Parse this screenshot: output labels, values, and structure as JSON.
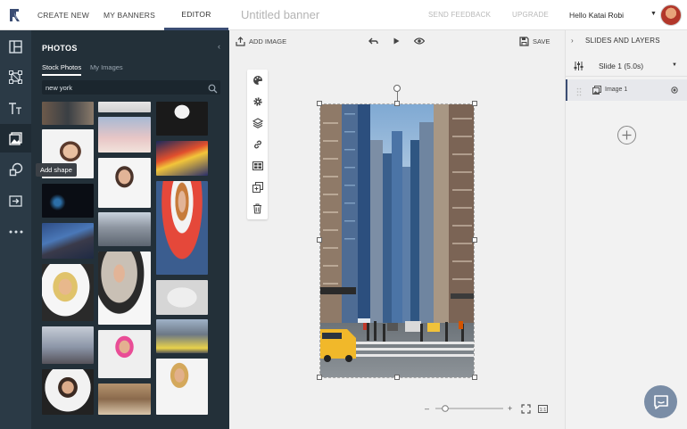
{
  "topbar": {
    "tabs": [
      {
        "label": "CREATE NEW"
      },
      {
        "label": "MY BANNERS"
      },
      {
        "label": "EDITOR"
      }
    ],
    "banner_title": "Untitled banner",
    "send_feedback": "SEND FEEDBACK",
    "upgrade": "UPGRADE",
    "hello": "Hello",
    "user_name": "Katai Robi",
    "colors": {
      "accent": "#3b4d73"
    }
  },
  "rail": {
    "icons": [
      "templates-icon",
      "transform-icon",
      "text-icon",
      "photos-icon",
      "shape-icon",
      "embed-icon",
      "more-icon"
    ],
    "tooltip": "Add shape"
  },
  "photos": {
    "title": "PHOTOS",
    "tabs": [
      {
        "label": "Stock Photos"
      },
      {
        "label": "My Images"
      }
    ],
    "search_value": "new york"
  },
  "editor": {
    "add_image": "ADD IMAGE",
    "save": "SAVE",
    "side_tools": [
      "palette-icon",
      "settings-icon",
      "layers-icon",
      "link-icon",
      "animation-icon",
      "duplicate-icon",
      "trash-icon"
    ]
  },
  "layers": {
    "title": "SLIDES AND LAYERS",
    "slide": "Slide 1 (5.0s)",
    "layer": "Image 1"
  }
}
